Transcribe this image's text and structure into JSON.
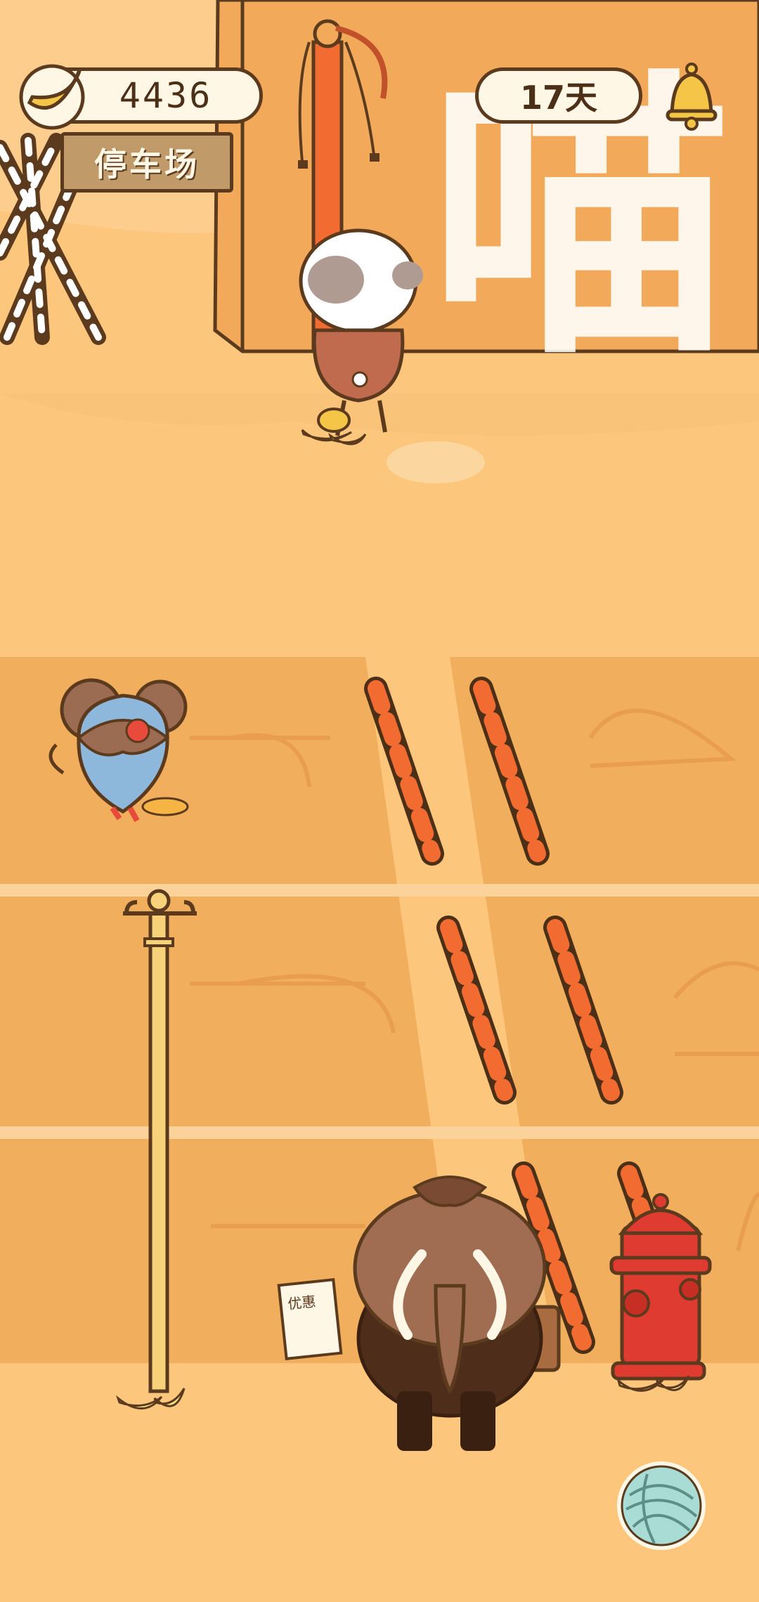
{
  "hud": {
    "bananas": "4436",
    "days": "17天",
    "location_sign": "停车场"
  },
  "wall": {
    "graffiti": "喵"
  },
  "icons": {
    "currency": "banana-icon",
    "notifications": "bell-icon",
    "menu": "yarn-ball-icon"
  },
  "colors": {
    "background": "#fcc77c",
    "wall": "#f2a95a",
    "parking_lot": "#f1ae5c",
    "outline": "#5b3a1e",
    "stripe_orange": "#f26c32",
    "stripe_dark": "#4b2f17"
  }
}
